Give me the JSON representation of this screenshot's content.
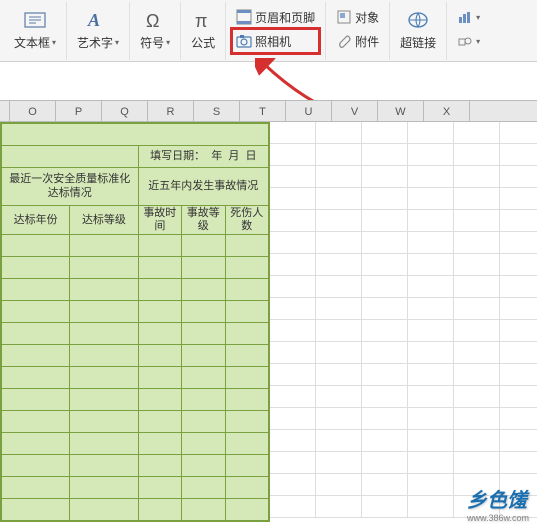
{
  "ribbon": {
    "textbox": "文本框",
    "wordart": "艺术字",
    "symbol": "符号",
    "formula": "公式",
    "camera": "照相机",
    "header_footer": "页眉和页脚",
    "object": "对象",
    "attachment": "附件",
    "hyperlink": "超链接"
  },
  "columns": [
    "O",
    "P",
    "Q",
    "R",
    "S",
    "T",
    "U",
    "V",
    "W",
    "X"
  ],
  "table": {
    "fill_date_label": "填写日期：",
    "fill_date_y": "年",
    "fill_date_m": "月",
    "fill_date_d": "日",
    "section_left": "最近一次安全质量标准化达标情况",
    "section_right": "近五年内发生事故情况",
    "col_year": "达标年份",
    "col_grade": "达标等级",
    "col_time": "事故时间",
    "col_level": "事故等级",
    "col_deaths": "死伤人数"
  },
  "watermark": {
    "brand": "乡色馐",
    "url": "www.386w.com"
  }
}
